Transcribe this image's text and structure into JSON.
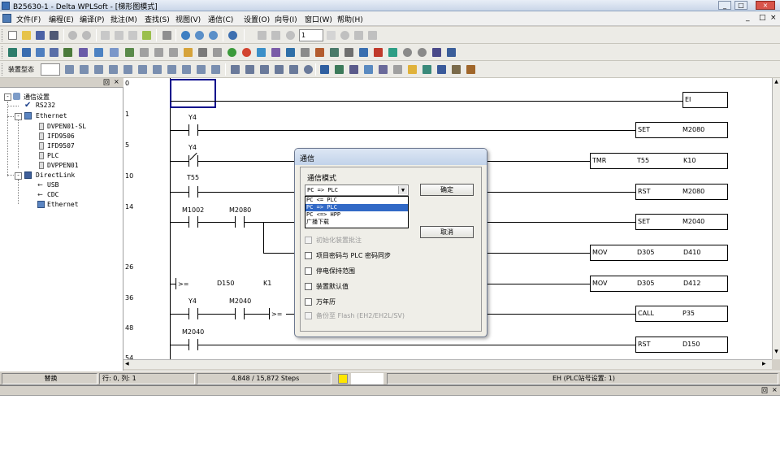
{
  "window": {
    "title": "B25630-1 - Delta WPLSoft - [梯形图模式]",
    "controls": [
      "_",
      "□",
      "×"
    ]
  },
  "menu": {
    "items": [
      "文件(F)",
      "编程(E)",
      "编译(P)",
      "批注(M)",
      "查找(S)",
      "视图(V)",
      "通信(C)",
      "设置(O)",
      "向导(I)",
      "窗口(W)",
      "帮助(H)"
    ],
    "mdi_controls": [
      "_",
      "□",
      "×"
    ]
  },
  "toolbar": {
    "step_value": "1",
    "device_label": "装置型态"
  },
  "left_panel": {
    "controls": [
      "回",
      "×"
    ],
    "tree": [
      {
        "label": "通信设置",
        "level": 0
      },
      {
        "label": "RS232",
        "level": 1
      },
      {
        "label": "Ethernet",
        "level": 1
      },
      {
        "label": "DVPEN01-SL",
        "level": 2
      },
      {
        "label": "IFD9506",
        "level": 2
      },
      {
        "label": "IFD9507",
        "level": 2
      },
      {
        "label": "PLC",
        "level": 2
      },
      {
        "label": "DVPPEN01",
        "level": 2
      },
      {
        "label": "DirectLink",
        "level": 1
      },
      {
        "label": "USB",
        "level": 2
      },
      {
        "label": "CDC",
        "level": 2
      },
      {
        "label": "Ethernet",
        "level": 2
      }
    ]
  },
  "ladder": {
    "rung_numbers": [
      "0",
      "1",
      "5",
      "10",
      "14",
      "26",
      "36",
      "48",
      "54"
    ],
    "contacts": [
      "Y4",
      "Y4",
      "T55",
      "M1002",
      "M2080",
      "D150",
      "K1",
      "Y4",
      "M2040",
      "M2040"
    ],
    "compare_label": ">=",
    "instructions": [
      {
        "op": "EI",
        "a": "",
        "b": ""
      },
      {
        "op": "SET",
        "a": "M2080",
        "b": ""
      },
      {
        "op": "TMR",
        "a": "T55",
        "b": "K10"
      },
      {
        "op": "RST",
        "a": "M2080",
        "b": ""
      },
      {
        "op": "SET",
        "a": "M2040",
        "b": ""
      },
      {
        "op": "MOV",
        "a": "D305",
        "b": "D410"
      },
      {
        "op": "MOV",
        "a": "D305",
        "b": "D412"
      },
      {
        "op": "CALL",
        "a": "P35",
        "b": ""
      },
      {
        "op": "RST",
        "a": "D150",
        "b": ""
      }
    ]
  },
  "status_bar": {
    "mode": "替换",
    "position": "行: 0, 列: 1",
    "steps": "4,848 / 15,872 Steps",
    "plc": "EH (PLC站号设置: 1)"
  },
  "dialog": {
    "title": "通信",
    "group_label": "通信模式",
    "combo_value": "PC => PLC",
    "options": [
      "PC <= PLC",
      "PC => PLC",
      "PC <=> HPP",
      "广播下载"
    ],
    "selected_index": 1,
    "ok_label": "确定",
    "cancel_label": "取消",
    "checkboxes": [
      {
        "label": "初始化装置批注",
        "disabled": true
      },
      {
        "label": "项目密码与 PLC 密码同步",
        "disabled": false
      },
      {
        "label": "停电保持范围",
        "disabled": false
      },
      {
        "label": "装置默认值",
        "disabled": false
      },
      {
        "label": "万年历",
        "disabled": false
      },
      {
        "label": "备份至 Flash (EH2/EH2L/SV)",
        "disabled": true
      }
    ]
  },
  "colors": {
    "selection": "#3169c6",
    "status_indicator": "#ffe600",
    "cursor_box": "#00008b"
  }
}
